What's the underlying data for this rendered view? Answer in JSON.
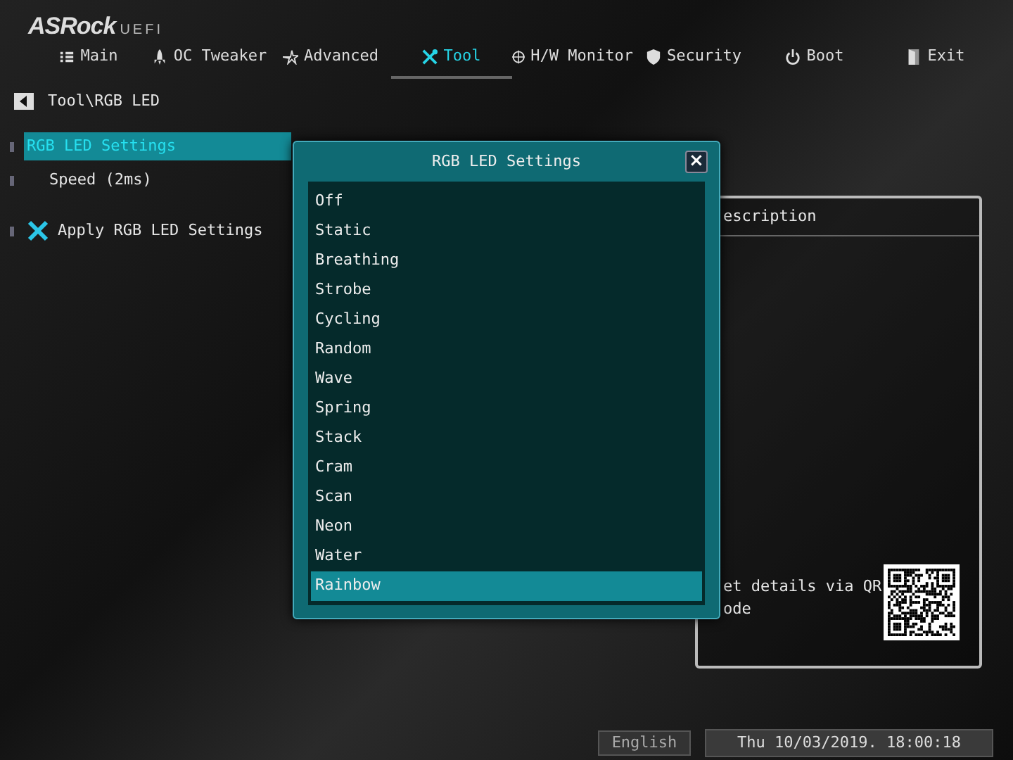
{
  "logo": {
    "brand": "ASRock",
    "suffix": "UEFI"
  },
  "tabs": [
    {
      "label": "Main",
      "selected": false
    },
    {
      "label": "OC Tweaker",
      "selected": false
    },
    {
      "label": "Advanced",
      "selected": false
    },
    {
      "label": "Tool",
      "selected": true
    },
    {
      "label": "H/W Monitor",
      "selected": false
    },
    {
      "label": "Security",
      "selected": false
    },
    {
      "label": "Boot",
      "selected": false
    },
    {
      "label": "Exit",
      "selected": false
    }
  ],
  "breadcrumb": "Tool\\RGB LED",
  "settings": [
    {
      "label": "RGB LED Settings",
      "kind": "plain",
      "selected": true
    },
    {
      "label": "Speed (2ms)",
      "kind": "indented",
      "selected": false
    },
    {
      "label": "Apply RGB LED Settings",
      "kind": "action",
      "selected": false
    }
  ],
  "description": {
    "title": "escription",
    "lines": [
      "et details via QR",
      "ode"
    ]
  },
  "dialog": {
    "title": "RGB LED Settings",
    "close": "×",
    "options": [
      {
        "label": "Off",
        "selected": false
      },
      {
        "label": "Static",
        "selected": false
      },
      {
        "label": "Breathing",
        "selected": false
      },
      {
        "label": "Strobe",
        "selected": false
      },
      {
        "label": "Cycling",
        "selected": false
      },
      {
        "label": "Random",
        "selected": false
      },
      {
        "label": "Wave",
        "selected": false
      },
      {
        "label": "Spring",
        "selected": false
      },
      {
        "label": "Stack",
        "selected": false
      },
      {
        "label": "Cram",
        "selected": false
      },
      {
        "label": "Scan",
        "selected": false
      },
      {
        "label": "Neon",
        "selected": false
      },
      {
        "label": "Water",
        "selected": false
      },
      {
        "label": "Rainbow",
        "selected": true
      }
    ]
  },
  "footer": {
    "language": "English",
    "datetime": "Thu 10/03/2019. 18:00:18"
  }
}
